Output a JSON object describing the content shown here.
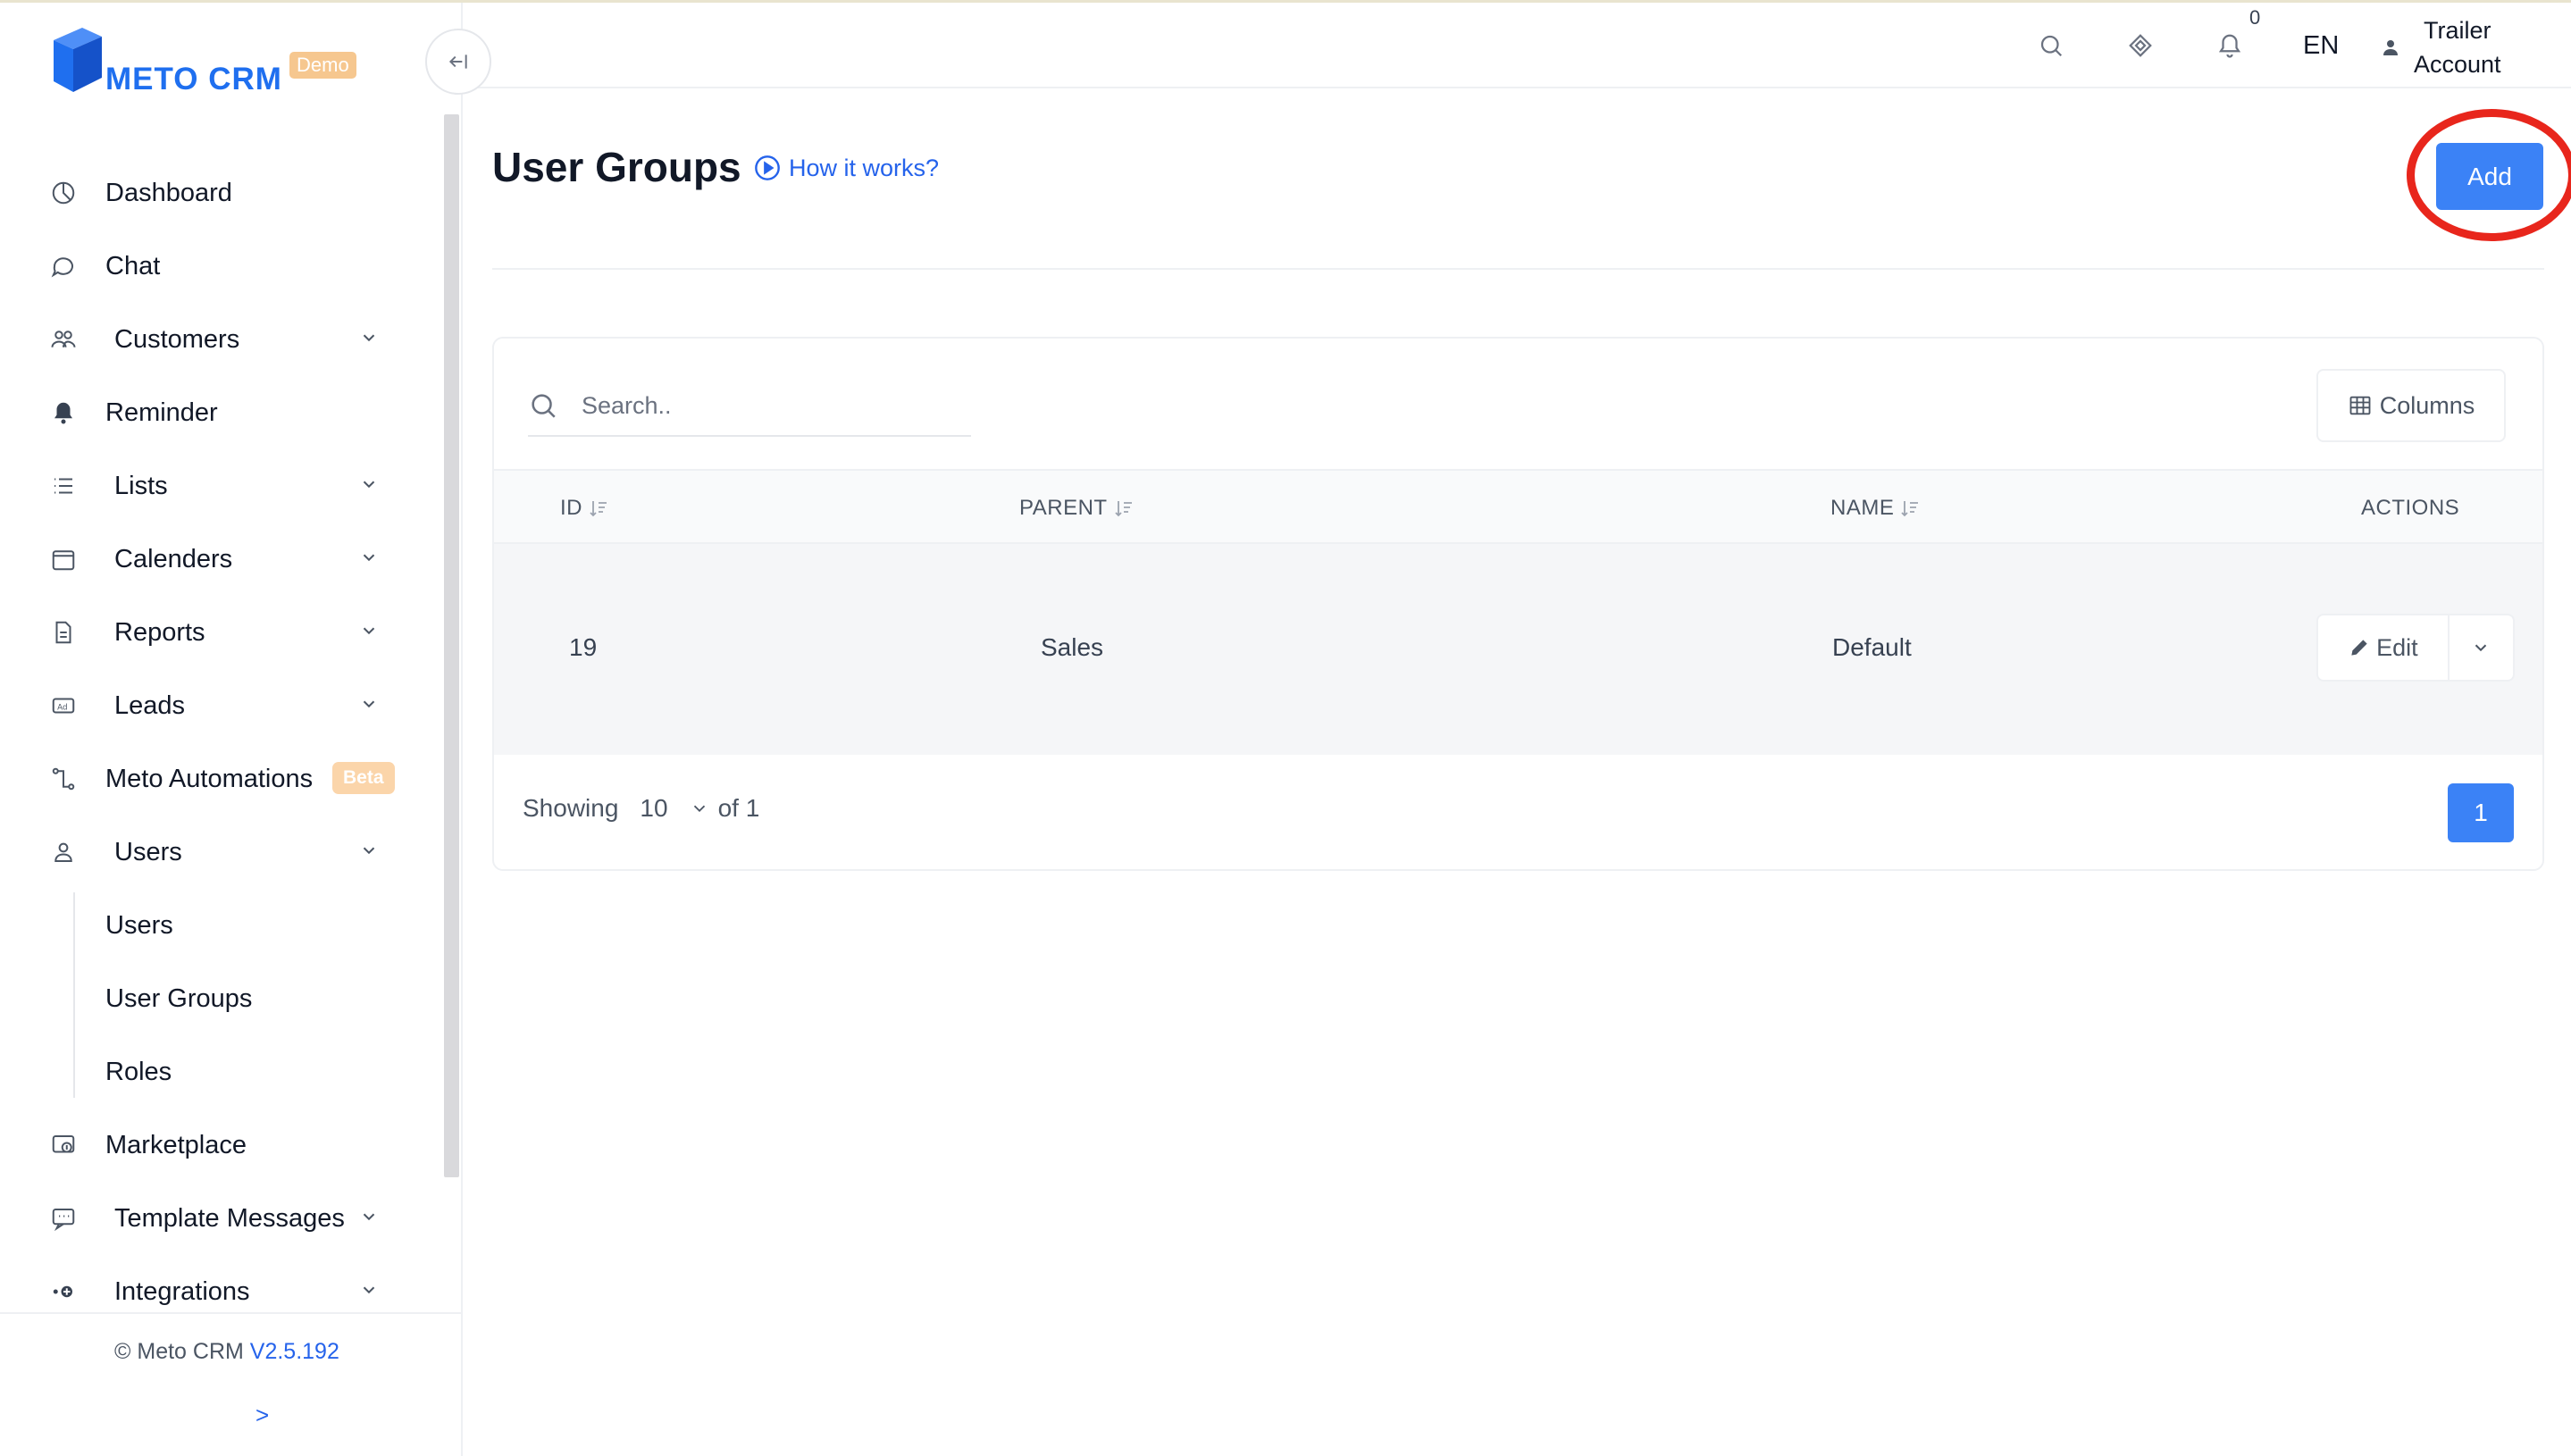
{
  "brand": {
    "name": "METO CRM",
    "badge": "Demo"
  },
  "sidebar": {
    "items": [
      {
        "label": "Dashboard",
        "icon": "dashboard-icon",
        "expandable": false
      },
      {
        "label": "Chat",
        "icon": "chat-icon",
        "expandable": false
      },
      {
        "label": "Customers",
        "icon": "customers-icon",
        "expandable": true
      },
      {
        "label": "Reminder",
        "icon": "bell-icon",
        "expandable": false
      },
      {
        "label": "Lists",
        "icon": "list-icon",
        "expandable": true
      },
      {
        "label": "Calenders",
        "icon": "calendar-icon",
        "expandable": true
      },
      {
        "label": "Reports",
        "icon": "report-icon",
        "expandable": true
      },
      {
        "label": "Leads",
        "icon": "ad-icon",
        "expandable": true
      },
      {
        "label": "Meto Automations",
        "icon": "automation-icon",
        "badge": "Beta",
        "expandable": false
      },
      {
        "label": "Users",
        "icon": "user-icon",
        "expandable": true,
        "children": [
          "Users",
          "User Groups",
          "Roles"
        ]
      },
      {
        "label": "Marketplace",
        "icon": "marketplace-icon",
        "expandable": false
      },
      {
        "label": "Template Messages",
        "icon": "template-message-icon",
        "expandable": true
      },
      {
        "label": "Integrations",
        "icon": "integration-icon",
        "expandable": true
      }
    ],
    "footer": {
      "copyright": "© Meto CRM",
      "version": "V2.5.192",
      "expand_label": ">"
    }
  },
  "topbar": {
    "notification_count": "0",
    "language": "EN",
    "account": {
      "line1": "Trailer",
      "line2": "Account"
    }
  },
  "main": {
    "title": "User Groups",
    "how_it_works": "How it works?",
    "add_label": "Add",
    "search_placeholder": "Search..",
    "columns_label": "Columns",
    "table": {
      "headers": [
        "ID",
        "PARENT",
        "NAME",
        "ACTIONS"
      ],
      "rows": [
        {
          "id": "19",
          "parent": "Sales",
          "name": "Default"
        }
      ],
      "edit_label": "Edit"
    },
    "pagination": {
      "showing_label": "Showing",
      "page_size": "10",
      "of_label": "of 1",
      "current_page": "1"
    }
  },
  "colors": {
    "accent": "#3b82f6",
    "brand": "#1f6fef",
    "highlight": "#e8261c",
    "beta": "#fbd5aa"
  }
}
